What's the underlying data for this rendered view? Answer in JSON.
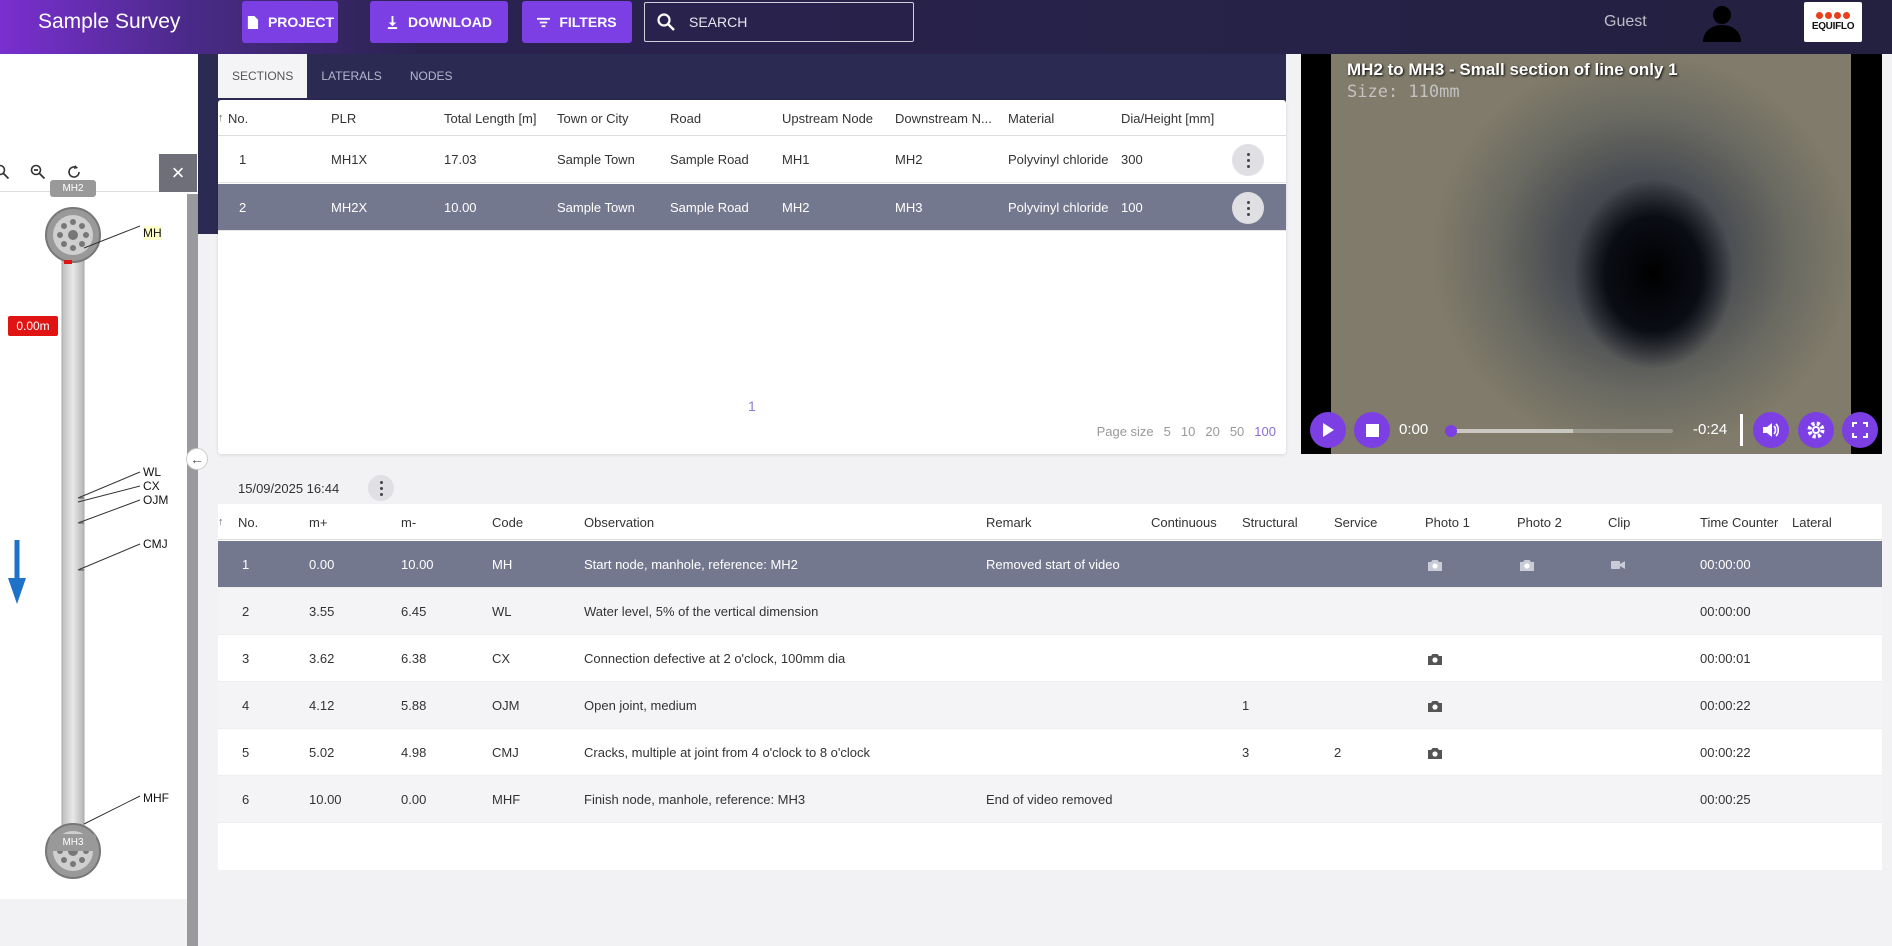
{
  "app": {
    "title": "Sample Survey"
  },
  "toolbar": {
    "project": "PROJECT",
    "download": "DOWNLOAD",
    "filters": "FILTERS",
    "search_placeholder": "SEARCH"
  },
  "user": {
    "name": "Guest"
  },
  "logo": {
    "text": "EQUIFLO",
    "accent": "#e8401c"
  },
  "colors": {
    "accent": "#7b3fe4",
    "header": "#2b2a52",
    "selected_row": "#74788f",
    "distance_badge": "#e11414"
  },
  "schematic": {
    "start_node": "MH2",
    "end_node": "MH3",
    "distance": "0.00m",
    "labels": [
      "MH",
      "WL",
      "CX",
      "OJM",
      "CMJ",
      "MHF"
    ]
  },
  "sections": {
    "tabs": [
      "SECTIONS",
      "LATERALS",
      "NODES"
    ],
    "columns": [
      "No.",
      "PLR",
      "Total Length [m]",
      "Town or City",
      "Road",
      "Upstream Node",
      "Downstream N...",
      "Material",
      "Dia/Height [mm]"
    ],
    "rows": [
      [
        "1",
        "MH1X",
        "17.03",
        "Sample Town",
        "Sample Road",
        "MH1",
        "MH2",
        "Polyvinyl chloride",
        "300"
      ],
      [
        "2",
        "MH2X",
        "10.00",
        "Sample Town",
        "Sample Road",
        "MH2",
        "MH3",
        "Polyvinyl chloride",
        "100"
      ]
    ],
    "selected_row": 2,
    "page": "1",
    "page_size_label": "Page size",
    "page_sizes": [
      "5",
      "10",
      "20",
      "50",
      "100"
    ],
    "page_size_selected": "100"
  },
  "video": {
    "title": "MH2 to MH3 - Small section of line only 1",
    "size_overlay": "Size: 110mm",
    "current_time": "0:00",
    "remaining_time": "-0:24",
    "progress": 0,
    "buffered_fraction": 0.55
  },
  "observations": {
    "date": "15/09/2025 16:44",
    "columns": [
      "No.",
      "m+",
      "m-",
      "Code",
      "Observation",
      "Remark",
      "Continuous",
      "Structural",
      "Service",
      "Photo 1",
      "Photo 2",
      "Clip",
      "Time Counter",
      "Lateral"
    ],
    "rows": [
      {
        "no": "1",
        "mp": "0.00",
        "mm": "10.00",
        "code": "MH",
        "obs": "Start node, manhole, reference: MH2",
        "remark": "Removed start of video",
        "continuous": "",
        "structural": "",
        "service": "",
        "photo1": "camera-icon",
        "photo2": "camera-icon",
        "clip": "video-icon",
        "time": "00:00:00",
        "lateral": ""
      },
      {
        "no": "2",
        "mp": "3.55",
        "mm": "6.45",
        "code": "WL",
        "obs": "Water level, 5% of the vertical dimension",
        "remark": "",
        "continuous": "",
        "structural": "",
        "service": "",
        "photo1": "",
        "photo2": "",
        "clip": "",
        "time": "00:00:00",
        "lateral": ""
      },
      {
        "no": "3",
        "mp": "3.62",
        "mm": "6.38",
        "code": "CX",
        "obs": "Connection defective at 2 o'clock, 100mm dia",
        "remark": "",
        "continuous": "",
        "structural": "",
        "service": "",
        "photo1": "camera-icon",
        "photo2": "",
        "clip": "",
        "time": "00:00:01",
        "lateral": ""
      },
      {
        "no": "4",
        "mp": "4.12",
        "mm": "5.88",
        "code": "OJM",
        "obs": "Open joint, medium",
        "remark": "",
        "continuous": "",
        "structural": "1",
        "service": "",
        "photo1": "camera-icon",
        "photo2": "",
        "clip": "",
        "time": "00:00:22",
        "lateral": ""
      },
      {
        "no": "5",
        "mp": "5.02",
        "mm": "4.98",
        "code": "CMJ",
        "obs": "Cracks, multiple at joint from 4 o'clock to 8 o'clock",
        "remark": "",
        "continuous": "",
        "structural": "3",
        "service": "2",
        "photo1": "camera-icon",
        "photo2": "",
        "clip": "",
        "time": "00:00:22",
        "lateral": ""
      },
      {
        "no": "6",
        "mp": "10.00",
        "mm": "0.00",
        "code": "MHF",
        "obs": "Finish node, manhole, reference: MH3",
        "remark": "End of video removed",
        "continuous": "",
        "structural": "",
        "service": "",
        "photo1": "",
        "photo2": "",
        "clip": "",
        "time": "00:00:25",
        "lateral": ""
      }
    ],
    "selected_row": 1
  }
}
